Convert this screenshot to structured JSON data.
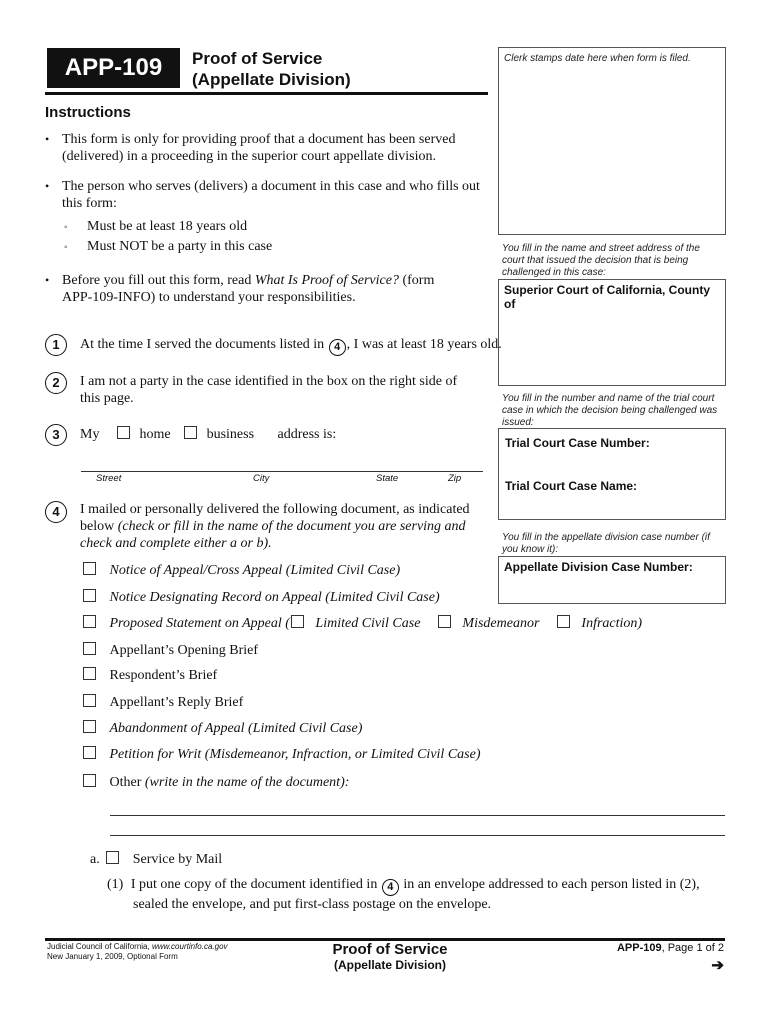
{
  "header": {
    "form_number": "APP-109",
    "title_line1": "Proof of Service",
    "title_line2": "(Appellate Division)"
  },
  "instructions": {
    "heading": "Instructions",
    "bullets": [
      {
        "line1": "This form is only for providing proof that a document has been served",
        "line2": "(delivered) in a proceeding in the superior court appellate division."
      },
      {
        "line1": "The person who serves (delivers) a document in this case and who fills out",
        "line2": "this form:"
      },
      {
        "pre": "Before you fill out this form, read ",
        "italic": "What Is Proof of Service?",
        "post": " (form",
        "line2": "APP-109-INFO) to understand your responsibilities."
      }
    ],
    "sub_bullets": [
      "Must be at least 18 years old",
      "Must NOT be a party in this case"
    ]
  },
  "right_column": {
    "clerk_box": "Clerk stamps date here when form is filed.",
    "court_hint": [
      "You fill in the name and street address of the",
      "court that issued the decision that is being",
      "challenged in this case:"
    ],
    "court_label": "Superior Court of California, County of",
    "trial_hint": [
      "You fill in the number and name of the trial court",
      "case in which the decision being challenged was",
      "issued:"
    ],
    "trial_number_label": "Trial Court Case Number:",
    "trial_name_label": "Trial Court Case Name:",
    "appellate_hint": [
      "You fill in the appellate division case number (if",
      "you know it):"
    ],
    "appellate_label": "Appellate Division Case Number:"
  },
  "items": {
    "item1": {
      "num": "1",
      "pre": "At the time I served the documents listed in ",
      "ref": "4",
      "post": ", I was at least 18 years old."
    },
    "item2": {
      "num": "2",
      "line1": "I am not a party in the case identified in the box on the right side of",
      "line2": "this page."
    },
    "item3": {
      "num": "3",
      "my": "My",
      "home": "home",
      "business": "business",
      "address": "address is:",
      "address_fields": [
        "Street",
        "City",
        "State",
        "Zip"
      ]
    },
    "item4": {
      "num": "4",
      "line1": "I mailed or personally delivered the following document, as indicated",
      "line2_pre": "below ",
      "line2_italic": "(check or fill in the name of the document you are serving and",
      "line3_italic": "check and complete either a or b)."
    }
  },
  "documents": [
    {
      "label": "Notice of Appeal/Cross Appeal (Limited Civil Case)",
      "italic": true,
      "checked": false
    },
    {
      "label": "Notice Designating Record on Appeal (Limited Civil Case)",
      "italic": true,
      "checked": false
    },
    {
      "label": "Proposed Statement on Appeal (",
      "italic": true,
      "checked": false,
      "sub_options": [
        "Limited Civil Case",
        "Misdemeanor",
        "Infraction)"
      ]
    },
    {
      "label": "Appellant’s Opening Brief",
      "italic": false,
      "checked": false
    },
    {
      "label": "Respondent’s Brief",
      "italic": false,
      "checked": false
    },
    {
      "label": "Appellant’s Reply Brief",
      "italic": false,
      "checked": false
    },
    {
      "label": "Abandonment of Appeal (Limited Civil Case)",
      "italic": true,
      "checked": false
    },
    {
      "label": "Petition for Writ (Misdemeanor, Infraction, or Limited Civil Case)",
      "italic": true,
      "checked": false
    },
    {
      "label": "Other",
      "italic_suffix": " (write in the name of the document):",
      "italic": false,
      "checked": false
    }
  ],
  "service": {
    "a_letter": "a.",
    "a_label": "Service by Mail",
    "a1_num": "(1)",
    "a1_pre": "I put one copy of the document identified in ",
    "a1_ref": "4",
    "a1_post": " in an envelope addressed to each person listed in (2),",
    "a1_line2": "sealed the envelope, and put first-class postage on the envelope."
  },
  "footer": {
    "left_line1_pre": "Judicial Council of California, ",
    "left_line1_url": "www.courtinfo.ca.gov",
    "left_line2": "New January 1, 2009, Optional Form",
    "center_title": "Proof of Service",
    "center_sub": "(Appellate Division)",
    "form_number": "APP-109",
    "page_text": ", Page 1 of 2",
    "next_arrow": "➔"
  }
}
